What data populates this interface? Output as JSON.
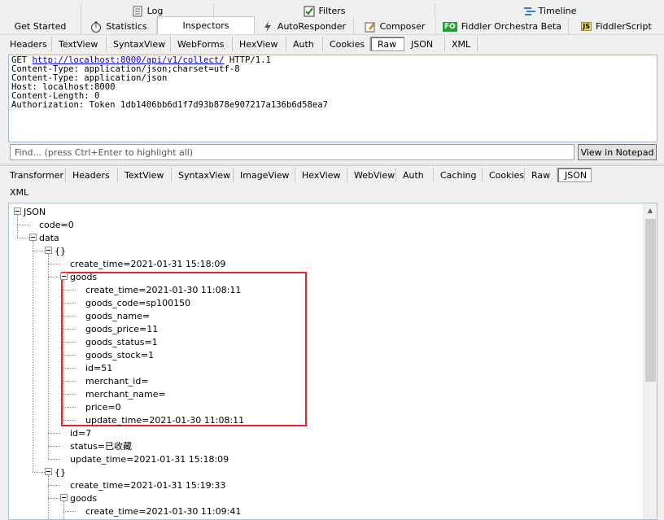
{
  "top_tabs": {
    "log": "Log",
    "filters": "Filters",
    "timeline": "Timeline"
  },
  "main_tabs": {
    "get_started": "Get Started",
    "statistics": "Statistics",
    "inspectors": "Inspectors",
    "autoresponder": "AutoResponder",
    "composer": "Composer",
    "orchestra": "Fiddler Orchestra Beta",
    "fiddlerscript": "FiddlerScript",
    "fo_badge": "FO",
    "js_badge": "JS"
  },
  "request_tabs": [
    "Headers",
    "TextView",
    "SyntaxView",
    "WebForms",
    "HexView",
    "Auth",
    "Cookies",
    "Raw",
    "JSON",
    "XML"
  ],
  "request_raw": {
    "method": "GET ",
    "url": "http://localhost:8000/api/v1/collect/",
    "protocol": " HTTP/1.1",
    "lines": [
      "Content-Type: application/json;charset=utf-8",
      "Content-Type: application/json",
      "Host: localhost:8000",
      "Content-Length: 0",
      "Authorization: Token 1db1406bb6d1f7d93b878e907217a136b6d58ea7"
    ]
  },
  "find": {
    "placeholder": "Find... (press Ctrl+Enter to highlight all)",
    "button": "View in Notepad"
  },
  "response_tabs": [
    "Transformer",
    "Headers",
    "TextView",
    "SyntaxView",
    "ImageView",
    "HexView",
    "WebView",
    "Auth",
    "Caching",
    "Cookies",
    "Raw",
    "JSON",
    "XML"
  ],
  "tree": [
    "JSON",
    "code=0",
    "data",
    "{}",
    "create_time=2021-01-31 15:18:09",
    "goods",
    "create_time=2021-01-30 11:08:11",
    "goods_code=sp100150",
    "goods_name=",
    "goods_price=11",
    "goods_status=1",
    "goods_stock=1",
    "id=51",
    "merchant_id=",
    "merchant_name=",
    "price=0",
    "update_time=2021-01-30 11:08:11",
    "id=7",
    "status=已收藏",
    "update_time=2021-01-31 15:18:09",
    "{}",
    "create_time=2021-01-31 15:19:33",
    "goods",
    "create_time=2021-01-30 11:09:41"
  ],
  "colors": {
    "highlight": "#e0282c",
    "link": "#0000ee"
  }
}
